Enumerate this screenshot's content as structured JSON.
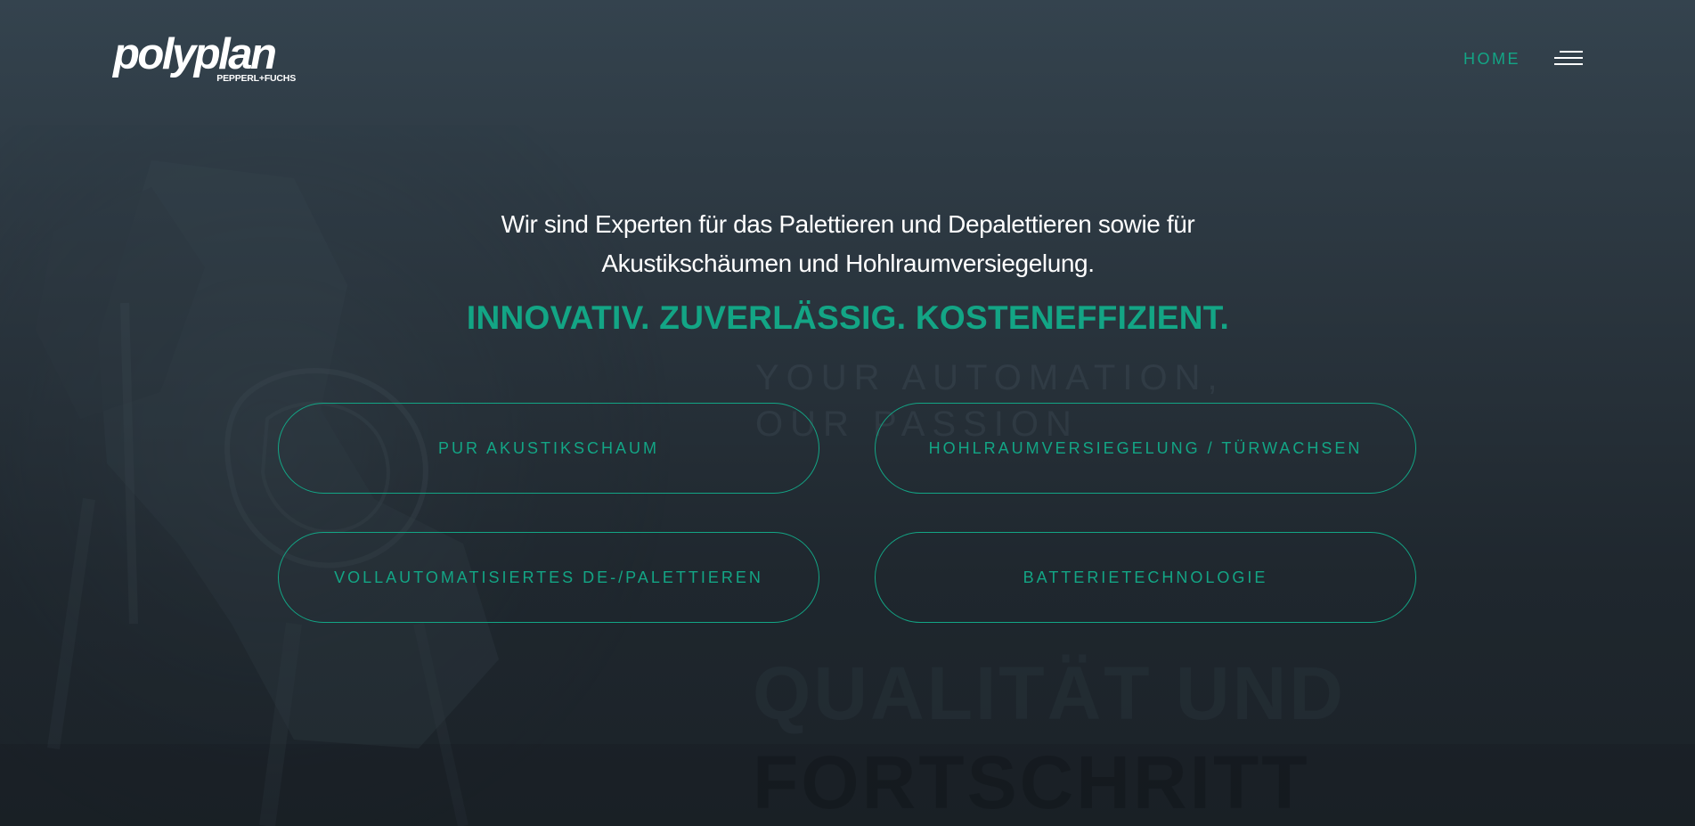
{
  "header": {
    "logo_text": "polyplan",
    "logo_subtext": "PEPPERL+FUCHS",
    "nav_home": "HOME",
    "menu_icon": "hamburger-menu-icon"
  },
  "hero": {
    "intro_line1": "Wir sind Experten für das Palettieren und Depalettieren sowie für",
    "intro_line2": "Akustikschäumen und Hohlraumversiegelung.",
    "slogan": "INNOVATIV. ZUVERLÄSSIG. KOSTENEFFIZIENT."
  },
  "buttons": [
    {
      "label": "PUR AKUSTIKSCHAUM"
    },
    {
      "label": "HOHLRAUMVERSIEGELUNG / TÜRWACHSEN"
    },
    {
      "label": "VOLLAUTOMATISIERTES DE-/PALETTIEREN"
    },
    {
      "label": "BATTERIETECHNOLOGIE"
    }
  ],
  "background": {
    "tagline_line1": "YOUR AUTOMATION,",
    "tagline_line2": "OUR PASSION",
    "headline_line1": "QUALITÄT UND",
    "headline_line2": "FORTSCHRITT"
  },
  "colors": {
    "accent": "#13a585",
    "background_top": "#34434e",
    "background_bottom": "#1b2228",
    "text": "#ffffff"
  }
}
